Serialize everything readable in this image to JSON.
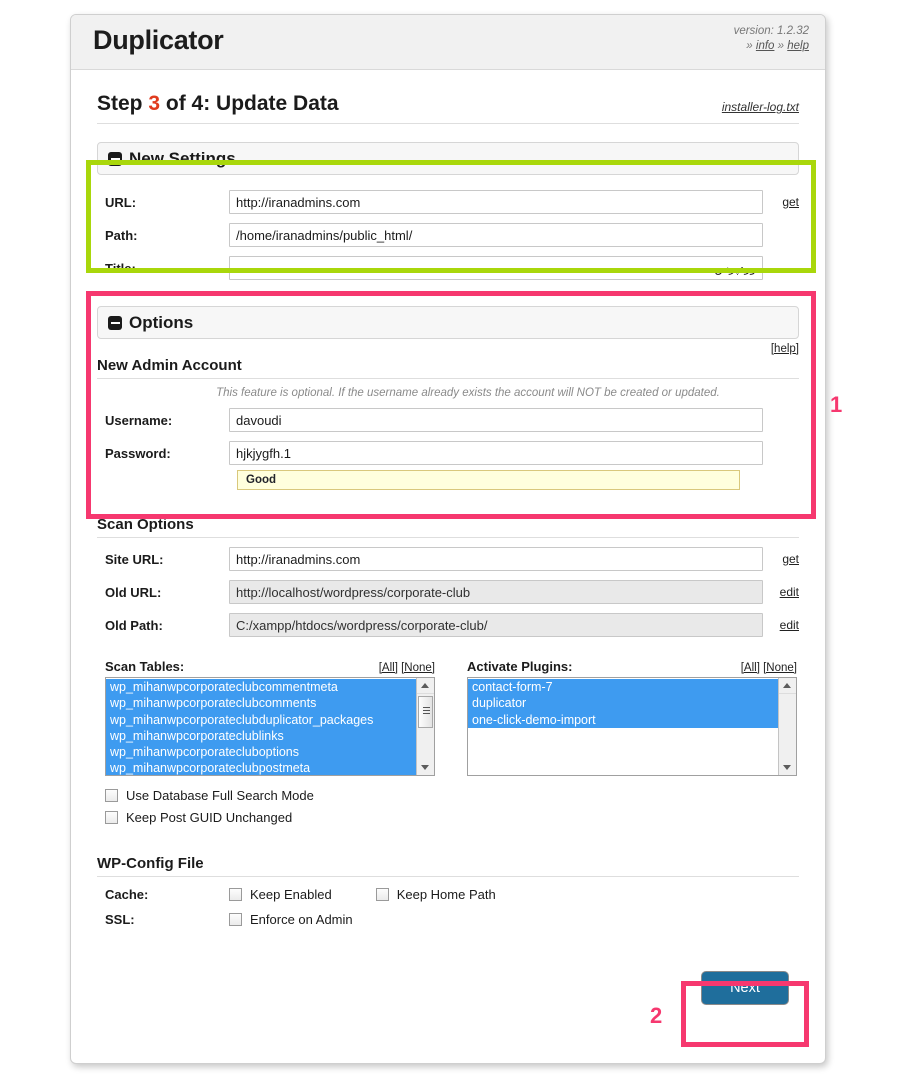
{
  "header": {
    "brand": "Duplicator",
    "version_label": "version: 1.2.32",
    "info_prefix": "»",
    "info_link": "info",
    "help_prefix": "»",
    "help_link": "help"
  },
  "step": {
    "prefix": "Step ",
    "number": "3",
    "suffix": " of 4: Update Data",
    "log_link": "installer-log.txt"
  },
  "new_settings": {
    "section_title": "New Settings",
    "toggle_icon": "minus-square-icon",
    "rows": [
      {
        "label": "URL:",
        "value": "http://iranadmins.com",
        "link": "get",
        "rtl": false,
        "readonly": false
      },
      {
        "label": "Path:",
        "value": "/home/iranadmins/public_html/",
        "link": "",
        "rtl": false,
        "readonly": false
      },
      {
        "label": "Title:",
        "value": "وردپرس",
        "link": "",
        "rtl": true,
        "readonly": false
      }
    ]
  },
  "options": {
    "section_title": "Options",
    "toggle_icon": "minus-square-icon",
    "help_link": "[help]",
    "sub_head": "New Admin Account",
    "note": "This feature is optional. If the username already exists the account will NOT be created or updated.",
    "username_label": "Username:",
    "username_value": "davoudi",
    "password_label": "Password:",
    "password_value": "hjkjygfh.1",
    "strength_text": "Good"
  },
  "scan_options": {
    "heading": "Scan Options",
    "rows": [
      {
        "label": "Site URL:",
        "value": "http://iranadmins.com",
        "link": "get",
        "readonly": false
      },
      {
        "label": "Old URL:",
        "value": "http://localhost/wordpress/corporate-club",
        "link": "edit",
        "readonly": true
      },
      {
        "label": "Old Path:",
        "value": "C:/xampp/htdocs/wordpress/corporate-club/",
        "link": "edit",
        "readonly": true
      }
    ],
    "scan_tables": {
      "label": "Scan Tables:",
      "all_link": "[All]",
      "none_link": "[None]",
      "items": [
        {
          "name": "wp_mihanwpcorporateclubcommentmeta",
          "selected": true
        },
        {
          "name": "wp_mihanwpcorporateclubcomments",
          "selected": true
        },
        {
          "name": "wp_mihanwpcorporateclubduplicator_packages",
          "selected": true
        },
        {
          "name": "wp_mihanwpcorporateclublinks",
          "selected": true
        },
        {
          "name": "wp_mihanwpcorporatecluboptions",
          "selected": true
        },
        {
          "name": "wp_mihanwpcorporateclubpostmeta",
          "selected": true
        }
      ]
    },
    "activate_plugins": {
      "label": "Activate Plugins:",
      "all_link": "[All]",
      "none_link": "[None]",
      "items": [
        {
          "name": "contact-form-7",
          "selected": true
        },
        {
          "name": "duplicator",
          "selected": true
        },
        {
          "name": "one-click-demo-import",
          "selected": true
        }
      ]
    },
    "checkboxes": [
      {
        "label": "Use Database Full Search Mode",
        "checked": false
      },
      {
        "label": "Keep Post GUID Unchanged",
        "checked": false
      }
    ]
  },
  "wp_config": {
    "heading": "WP-Config File",
    "cache_label": "Cache:",
    "cache_opt1": "Keep Enabled",
    "cache_opt2": "Keep Home Path",
    "ssl_label": "SSL:",
    "ssl_opt1": "Enforce on Admin"
  },
  "footer": {
    "next_label": "Next"
  },
  "annotations": {
    "marker_1": "1",
    "marker_2": "2",
    "green_color": "#a9d70b",
    "pink_color": "#f6386f"
  }
}
